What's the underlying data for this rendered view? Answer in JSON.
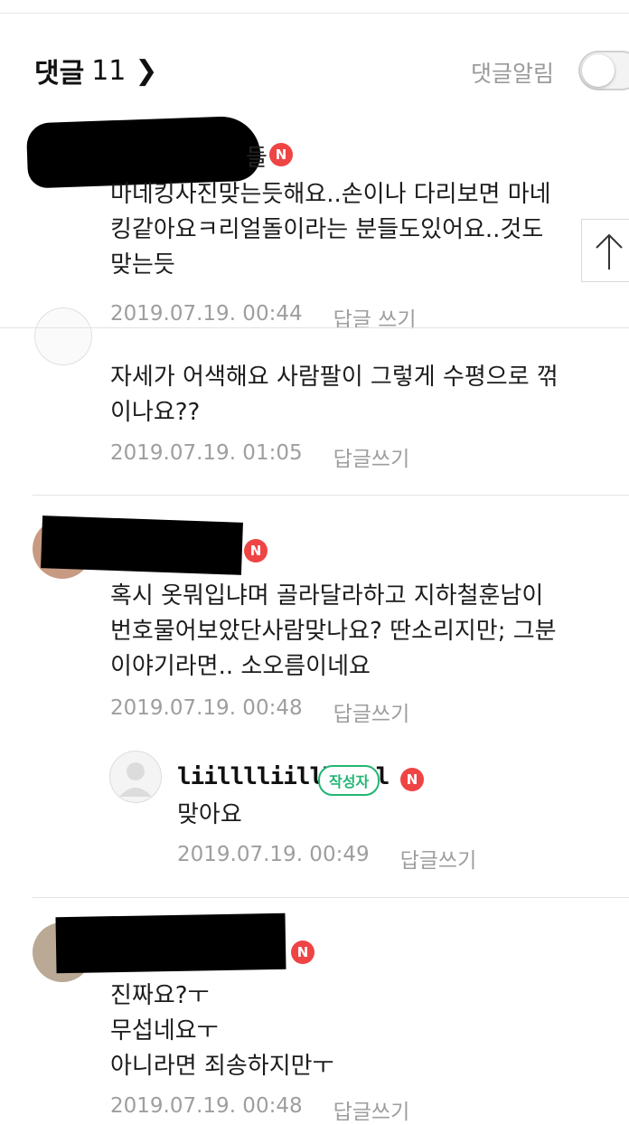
{
  "header": {
    "title": "댓글",
    "count": "11",
    "chevron": "chevron-right-icon",
    "alarm_label": "댓글알림",
    "alarm_enabled": false
  },
  "comments": [
    {
      "text": "마네킹사진맞는듯해요..손이나 다리보면 마네\n킹같아요ㅋ리얼돌이라는 분들도있어요..것도\n맞는듯",
      "date": "2019.07.19. 00:44",
      "reply_label": "답글 쓰기",
      "badge": "N",
      "name_tail": "들"
    },
    {
      "text": "자세가 어색해요 사람팔이 그렇게 수평으로 꺾\n이나요??",
      "date": "2019.07.19. 01:05",
      "reply_label": "답글쓰기"
    },
    {
      "text": "혹시 옷뭐입냐며 골라달라하고 지하철훈남이\n번호물어보았단사람맞나요? 딴소리지만; 그분\n이야기라면.. 소오름이네요",
      "date": "2019.07.19. 00:48",
      "reply_label": "답글쓰기",
      "badge": "N"
    },
    {
      "text": "진짜요?ㅜ\n무섭네요ㅜ\n아니라면 죄송하지만ㅜ",
      "date": "2019.07.19. 00:48",
      "reply_label": "답글쓰기",
      "badge": "N"
    }
  ],
  "reply": {
    "username": "liilllliilllilll",
    "author_badge": "작성자",
    "badge": "N",
    "text": "맞아요",
    "date": "2019.07.19. 00:49",
    "reply_label": "답글쓰기"
  },
  "scroll_top_icon": "arrow-up-icon"
}
